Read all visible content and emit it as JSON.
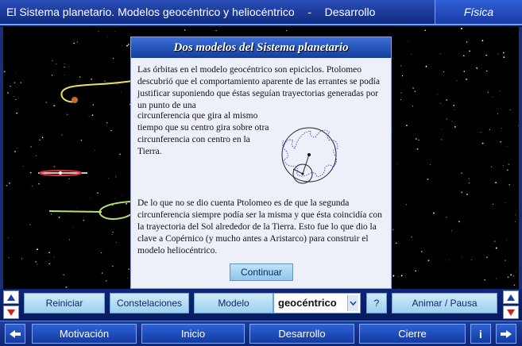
{
  "window": {
    "title_left": "El Sistema planetario. Modelos geocéntrico y heliocéntrico",
    "title_sep": "-",
    "title_right": "Desarrollo",
    "badge": "Física"
  },
  "dialog": {
    "title": "Dos modelos del Sistema planetario",
    "paragraph1": "Las órbitas en el modelo geocéntrico son epiciclos. Ptolomeo descubrió que el comportamiento aparente de las errantes se podía justificar suponiendo que éstas seguían trayectorias generadas por un punto de una",
    "paragraph2": "circunferencia que gira al mismo tiempo que su centro gira sobre otra circunferencia con centro en la Tierra.",
    "paragraph3": "De lo que no se dio cuenta Ptolomeo es de que la segunda circunferencia siempre podía ser la misma y que ésta coincidía con la trayectoria del Sol alrededor de la Tierra. Esto fue lo que dio la clave a Copérnico (y mucho antes a Aristarco) para construir el modelo heliocéntrico.",
    "continue_label": "Continuar"
  },
  "controls": {
    "reset_label": "Reiniciar",
    "constellations_label": "Constelaciones",
    "model_label": "Modelo",
    "model_selected": "geocéntrico",
    "help_label": "?",
    "animate_label": "Animar / Pausa"
  },
  "nav": {
    "motivation": "Motivación",
    "start": "Inicio",
    "development": "Desarrollo",
    "closing": "Cierre",
    "info": "i"
  },
  "icons": {
    "scroll_up": "triangle-up-icon",
    "scroll_down": "triangle-down-icon",
    "prev": "arrow-left-icon",
    "next": "arrow-right-icon",
    "dropdown": "chevron-down-icon"
  },
  "colors": {
    "accent": "#1a3aa6",
    "button_light": "#9dd0f0",
    "orbit": "#e8e060",
    "orbit_green": "#b8e070"
  }
}
